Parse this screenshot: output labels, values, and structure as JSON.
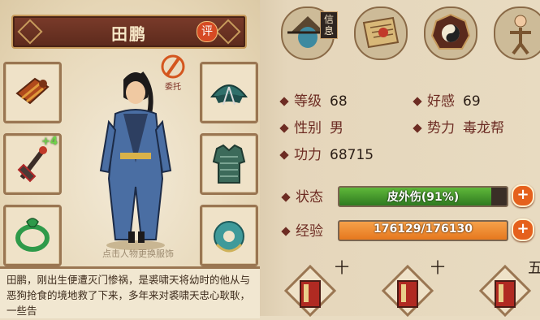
{
  "hero": {
    "name": "田鹏",
    "rate_badge": "评",
    "entrust_label": "委托",
    "tap_hint": "点击人物更换服饰",
    "bio": "田鹏，刚出生便遭灭门惨祸，是裘啸天将幼时的他从与恶狗抢食的境地救了下来，多年来对裘啸天忠心耿耿，一些告"
  },
  "equipment": {
    "left": [
      {
        "name": "bracer",
        "plus": ""
      },
      {
        "name": "weapon",
        "plus": "+4"
      },
      {
        "name": "ring",
        "plus": ""
      }
    ],
    "right": [
      {
        "name": "helmet"
      },
      {
        "name": "armor"
      },
      {
        "name": "accessory"
      }
    ]
  },
  "top_icons": {
    "info_tag": "信息",
    "items": [
      "hero-portrait-icon",
      "scroll-icon",
      "bagua-icon",
      "skills-icon"
    ]
  },
  "stats": {
    "level_label": "等级",
    "level": "68",
    "affinity_label": "好感",
    "affinity": "69",
    "gender_label": "性别",
    "gender": "男",
    "faction_label": "势力",
    "faction": "毒龙帮",
    "power_label": "功力",
    "power": "68715"
  },
  "status": {
    "label": "状态",
    "text": "皮外伤(91%)",
    "percent": 91,
    "color": "#5fb83a"
  },
  "experience": {
    "label": "经验",
    "text": "176129/176130",
    "current": 176129,
    "max": 176130,
    "color": "#e6781e"
  },
  "skill_books": {
    "plus_marks": [
      "十",
      "十",
      "五"
    ]
  }
}
